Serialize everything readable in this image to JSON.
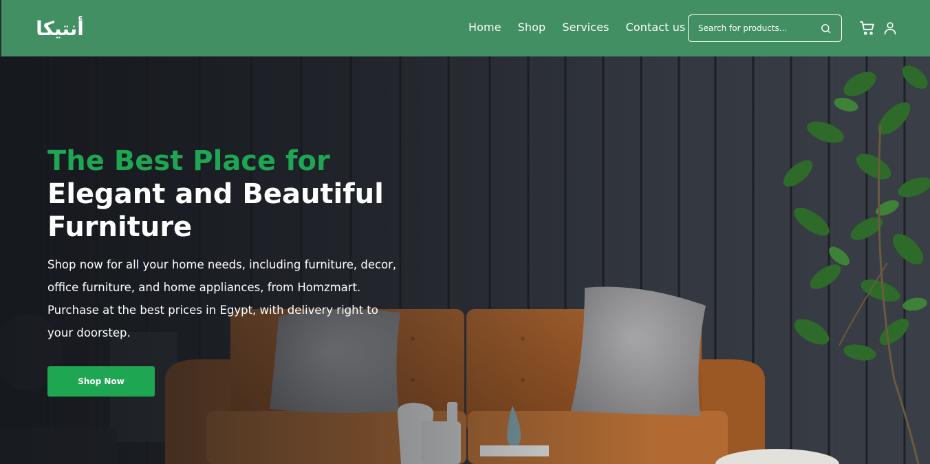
{
  "nav": {
    "logo_text": "أنتيكا",
    "links": [
      "Home",
      "Shop",
      "Services",
      "Contact us"
    ],
    "search_placeholder": "Search for products...",
    "icons": [
      "search-icon",
      "cart-icon",
      "user-icon"
    ]
  },
  "hero": {
    "title_line1": "The Best Place for",
    "title_line2": "Elegant and Beautiful",
    "title_line3": "Furniture",
    "description": "Shop now for all your home needs, including furniture, decor, office furniture, and home appliances, from Homzmart. Purchase at the best prices in Egypt, with delivery right to your doorstep.",
    "cta_label": "Shop Now"
  },
  "colors": {
    "nav_bg": "#418f63",
    "accent_green": "#1fa653",
    "hero_bg": "#2a2d33"
  }
}
